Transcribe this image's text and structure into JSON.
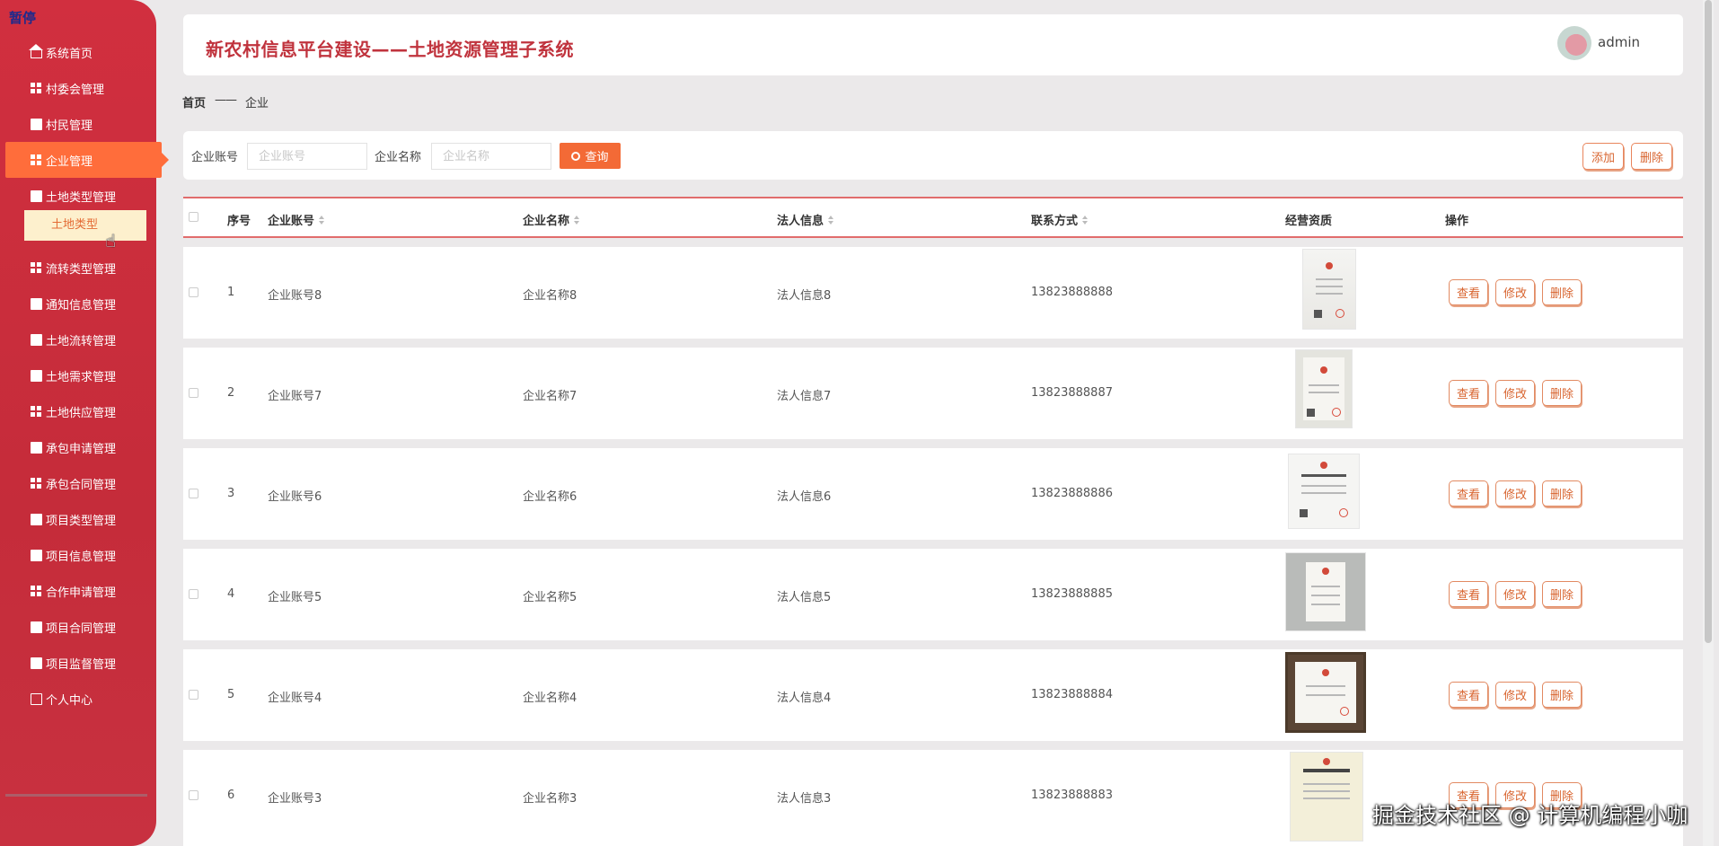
{
  "status": {
    "paused": "暂停"
  },
  "sidebar": {
    "items": [
      {
        "label": "系统首页",
        "icon": "home-icon"
      },
      {
        "label": "村委会管理",
        "icon": "grid-icon"
      },
      {
        "label": "村民管理",
        "icon": "chart-icon"
      },
      {
        "label": "企业管理",
        "icon": "grid-icon",
        "active": true
      },
      {
        "label": "土地类型管理",
        "icon": "briefcase-icon"
      },
      {
        "label": "流转类型管理",
        "icon": "grid-icon"
      },
      {
        "label": "通知信息管理",
        "icon": "document-icon"
      },
      {
        "label": "土地流转管理",
        "icon": "cup-icon"
      },
      {
        "label": "土地需求管理",
        "icon": "thumb-icon"
      },
      {
        "label": "土地供应管理",
        "icon": "grid-icon"
      },
      {
        "label": "承包申请管理",
        "icon": "comment-icon"
      },
      {
        "label": "承包合同管理",
        "icon": "grid-icon"
      },
      {
        "label": "项目类型管理",
        "icon": "clipboard-icon"
      },
      {
        "label": "项目信息管理",
        "icon": "monitor-icon"
      },
      {
        "label": "合作申请管理",
        "icon": "grid-icon"
      },
      {
        "label": "项目合同管理",
        "icon": "print-icon"
      },
      {
        "label": "项目监督管理",
        "icon": "chart-icon"
      },
      {
        "label": "个人中心",
        "icon": "calendar-icon"
      }
    ],
    "sub_item": "土地类型"
  },
  "header": {
    "title": "新农村信息平台建设——土地资源管理子系统",
    "user": "admin"
  },
  "breadcrumb": {
    "home": "首页",
    "separator": "——",
    "current": "企业"
  },
  "search": {
    "account_label": "企业账号",
    "account_placeholder": "企业账号",
    "name_label": "企业名称",
    "name_placeholder": "企业名称",
    "query_label": "查询",
    "add_label": "添加",
    "delete_label": "删除"
  },
  "table": {
    "headers": {
      "index": "序号",
      "account": "企业账号",
      "name": "企业名称",
      "legal": "法人信息",
      "contact": "联系方式",
      "license": "经营资质",
      "actions": "操作"
    },
    "action_labels": {
      "view": "查看",
      "edit": "修改",
      "delete": "删除"
    },
    "rows": [
      {
        "index": "1",
        "account": "企业账号8",
        "name": "企业名称8",
        "legal": "法人信息8",
        "contact": "13823888888"
      },
      {
        "index": "2",
        "account": "企业账号7",
        "name": "企业名称7",
        "legal": "法人信息7",
        "contact": "13823888887"
      },
      {
        "index": "3",
        "account": "企业账号6",
        "name": "企业名称6",
        "legal": "法人信息6",
        "contact": "13823888886"
      },
      {
        "index": "4",
        "account": "企业账号5",
        "name": "企业名称5",
        "legal": "法人信息5",
        "contact": "13823888885"
      },
      {
        "index": "5",
        "account": "企业账号4",
        "name": "企业名称4",
        "legal": "法人信息4",
        "contact": "13823888884"
      },
      {
        "index": "6",
        "account": "企业账号3",
        "name": "企业名称3",
        "legal": "法人信息3",
        "contact": "13823888883"
      }
    ]
  },
  "watermark": "掘金技术社区 @ 计算机编程小咖",
  "colors": {
    "sidebar": "#c82d3c",
    "accent": "#f36a36",
    "title": "#c0333d",
    "active_sub_bg": "#fdf0cd"
  }
}
